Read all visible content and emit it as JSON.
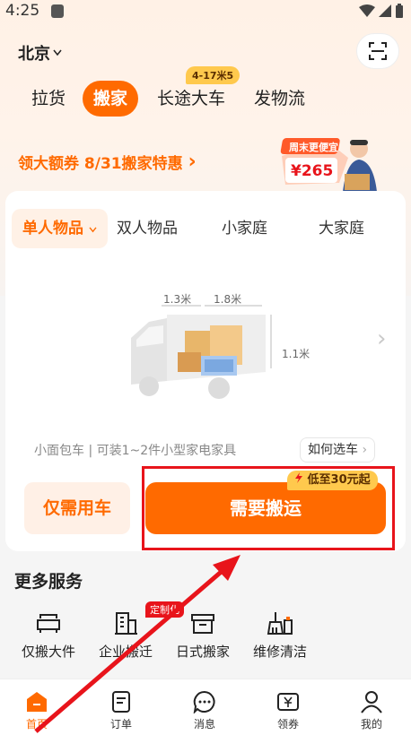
{
  "status_bar": {
    "time": "4:25"
  },
  "header": {
    "city": "北京",
    "scan_icon": "scan-icon"
  },
  "tabs": [
    {
      "label": "拉货"
    },
    {
      "label": "搬家",
      "active": true
    },
    {
      "label": "长途大车",
      "badge": "4-17米5"
    },
    {
      "label": "发物流"
    }
  ],
  "promo": {
    "text": "领大额券 8/31搬家特惠",
    "arrow": "›",
    "image_title": "周末更便宜",
    "image_price": "¥265"
  },
  "size_tabs": [
    {
      "label": "单人物品",
      "active": true
    },
    {
      "label": "双人物品"
    },
    {
      "label": "小家庭"
    },
    {
      "label": "大家庭"
    }
  ],
  "vehicle": {
    "dims": {
      "height": "1.3米",
      "length": "1.8米",
      "width": "1.1米"
    },
    "info": "小面包车 | 可装1~2件小型家电家具",
    "choose_btn": "如何选车"
  },
  "actions": {
    "car_only": "仅需用车",
    "need_move": "需要搬运",
    "price_badge": "低至30元起"
  },
  "more_services": {
    "title": "更多服务",
    "items": [
      {
        "label": "仅搬大件",
        "icon": "sofa-icon"
      },
      {
        "label": "企业搬迁",
        "icon": "building-icon",
        "badge": "定制化"
      },
      {
        "label": "日式搬家",
        "icon": "box-icon"
      },
      {
        "label": "维修清洁",
        "icon": "broom-icon"
      }
    ]
  },
  "bottom_nav": [
    {
      "label": "首页",
      "icon": "home-icon",
      "active": true
    },
    {
      "label": "订单",
      "icon": "order-icon"
    },
    {
      "label": "消息",
      "icon": "message-icon"
    },
    {
      "label": "领券",
      "icon": "coupon-icon"
    },
    {
      "label": "我的",
      "icon": "profile-icon"
    }
  ],
  "colors": {
    "accent": "#ff6a00",
    "highlight": "#e8141b",
    "badge": "#ffc94d"
  }
}
